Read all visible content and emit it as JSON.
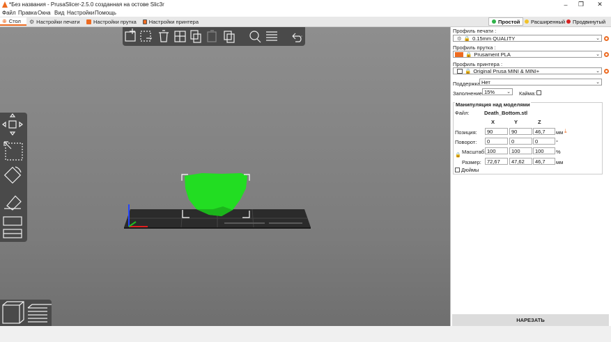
{
  "window": {
    "title": "*Без названия - PrusaSlicer-2.5.0 созданная на остове Slic3r",
    "minimize": "–",
    "maximize": "❐",
    "close": "✕"
  },
  "menu": [
    "Файл",
    "Правка",
    "Окна",
    "Вид",
    "Настройки",
    "Помощь"
  ],
  "tabs": [
    {
      "label": "Стол",
      "active": true
    },
    {
      "label": "Настройки печати",
      "active": false
    },
    {
      "label": "Настройки прутка",
      "active": false
    },
    {
      "label": "Настройки принтера",
      "active": false
    }
  ],
  "modes": [
    {
      "label": "Простой",
      "color": "#2fb34a",
      "active": true
    },
    {
      "label": "Расширенный",
      "color": "#f2c32a",
      "active": false
    },
    {
      "label": "Продвинутый",
      "color": "#d92121",
      "active": false
    }
  ],
  "colors": {
    "accent": "#ed6b21",
    "model": "#22dd22",
    "toolbar": "#4a4a4a"
  },
  "sidebar": {
    "print_profile": {
      "label": "Профиль печати :",
      "value": "0.15mm QUALITY"
    },
    "filament_profile": {
      "label": "Профиль прутка :",
      "value": "Prusament PLA",
      "swatch": "#ed6b21"
    },
    "printer_profile": {
      "label": "Профиль принтера :",
      "value": "Original Prusa MINI & MINI+"
    },
    "supports": {
      "label": "Поддержка:",
      "value": "Нет"
    },
    "infill": {
      "label": "Заполнение:",
      "value": "15%"
    },
    "brim": {
      "label": "Кайма:"
    },
    "manipulation": {
      "title": "Манипуляция над моделями",
      "file_label": "Файл:",
      "file_name": "Death_Bottom.stl",
      "axes": [
        "X",
        "Y",
        "Z"
      ],
      "position": {
        "label": "Позиция:",
        "values": [
          "90",
          "90",
          "46,7"
        ],
        "unit": "мм"
      },
      "rotation": {
        "label": "Поворот:",
        "values": [
          "0",
          "0",
          "0"
        ],
        "unit": "°"
      },
      "scale": {
        "label": "Масштаб:",
        "values": [
          "100",
          "100",
          "100"
        ],
        "unit": "%"
      },
      "size": {
        "label": "Размер:",
        "values": [
          "72,67",
          "47,62",
          "46,7"
        ],
        "unit": "мм"
      },
      "inches_label": "Дюймы"
    }
  },
  "slice_button": "НАРЕЗАТЬ",
  "toolbar_icons": [
    "add-object-icon",
    "delete-icon",
    "delete-all-icon",
    "arrange-icon",
    "copy-icon",
    "paste-icon",
    "add-instance-icon",
    "remove-instance-icon",
    "split-icon",
    "search-icon",
    "layers-editing-icon",
    "undo-icon",
    "redo-icon"
  ],
  "left_tools": [
    "move-icon",
    "scale-icon",
    "rotate-icon",
    "place-on-face-icon",
    "cut-icon",
    "support-paint-icon"
  ],
  "view_modes": [
    "3d-view-icon",
    "preview-icon"
  ]
}
